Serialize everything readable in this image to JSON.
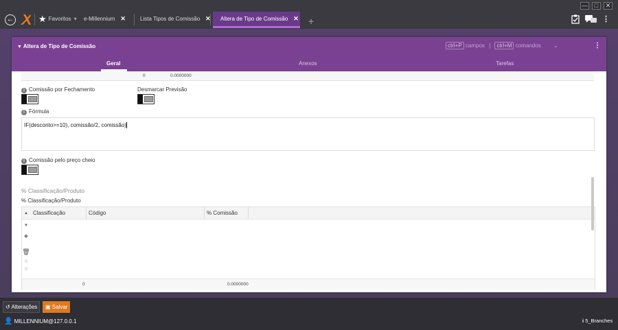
{
  "window": {
    "controls": [
      "—",
      "□",
      "✕"
    ]
  },
  "nav": {
    "tabs": [
      {
        "label": "Favoritos",
        "arrow": "▾"
      },
      {
        "label": "e-Millennium",
        "close": "✕"
      },
      {
        "label": "Lista Tipos de Comissão",
        "close": "✕"
      },
      {
        "label": "Altera de Tipo de Comissão",
        "close": "✕"
      }
    ],
    "add_tab": "+"
  },
  "panel": {
    "title": "Altera de Tipo de Comissão",
    "shortcut_fields_key": "ctrl+P",
    "shortcut_fields_label": "campos",
    "shortcut_sep": "|",
    "shortcut_commands_key": "ctrl+M",
    "shortcut_commands_label": "comandos",
    "tabs": [
      "Geral",
      "Anexos",
      "Tarefas"
    ]
  },
  "form": {
    "top_summary": {
      "count": "0",
      "value": "0.0000000"
    },
    "comissao_fechamento_label": "Comissão por Fechamento",
    "desmarcar_previsao_label": "Desmarcar Previsão",
    "formula_label": "Fórmula",
    "formula_value": "IF(desconto>=10), comissão/2, comissão)",
    "comissao_preco_cheio_label": "Comissão pelo preço cheio",
    "section_title": "% Classificação/Produto",
    "grid_title": "% Classificação/Produto",
    "grid": {
      "columns": [
        "Classificação",
        "Código",
        "% Comissão"
      ],
      "sort_icon": "▲",
      "side_nums": [
        "0",
        "0"
      ],
      "footer": {
        "count": "0",
        "value": "0.0000000"
      }
    }
  },
  "bottom": {
    "alteracoes_label": "Alterações",
    "salvar_label": "Salvar",
    "user": "MILLENNIUM@127.0.0.1",
    "branch": "5_Branches"
  }
}
